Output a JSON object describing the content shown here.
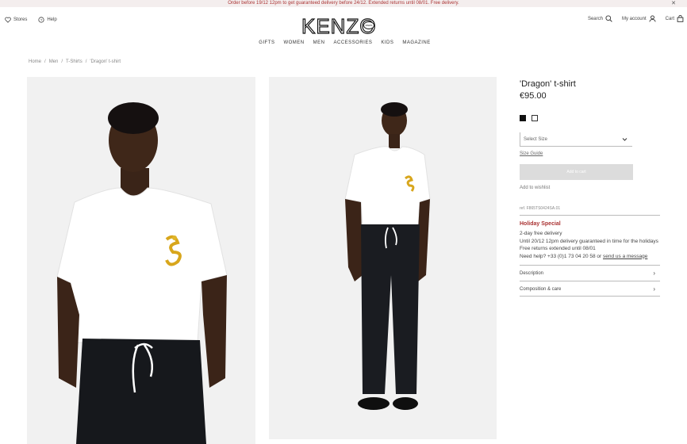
{
  "promo": {
    "text": "Order before 19/12 12pm to get guaranteed delivery before 24/12. Extended returns until 08/01. Free delivery.",
    "close_icon": "close-icon"
  },
  "topbar": {
    "stores_label": "Stores",
    "help_label": "Help",
    "search_label": "Search",
    "account_label": "My account",
    "cart_label": "Cart"
  },
  "logo": {
    "text": "KENZO",
    "badge": "PARIS"
  },
  "nav": [
    "GIFTS",
    "WOMEN",
    "MEN",
    "ACCESSORIES",
    "KIDS",
    "MAGAZINE"
  ],
  "breadcrumb": [
    "Home",
    "/",
    "Men",
    "/",
    "T-Shirts",
    "/",
    "'Dragon' t-shirt"
  ],
  "product": {
    "title": "'Dragon' t-shirt",
    "price": "€95.00",
    "colors": [
      "black",
      "white"
    ],
    "size_placeholder": "Select Size",
    "size_guide": "Size Guide",
    "add_to_cart": "Add to cart",
    "wishlist": "Add to wishlist",
    "reference": "ref. F865TS0424SA.01"
  },
  "holiday": {
    "title": "Holiday Special",
    "lines": [
      "2-day free delivery",
      "Until 20/12 12pm delivery guaranteed in time for the holidays",
      "Free returns extended until 08/01"
    ],
    "help_prefix": "Need help? +33 (0)1 73 04 20 58 or",
    "help_link": "send us a message"
  },
  "accordion": [
    {
      "label": "Description"
    },
    {
      "label": "Composition & care"
    }
  ],
  "colors": {
    "promo_text": "#aa3333",
    "holiday_accent": "#aa3333",
    "button_disabled": "#dcdcdc"
  }
}
